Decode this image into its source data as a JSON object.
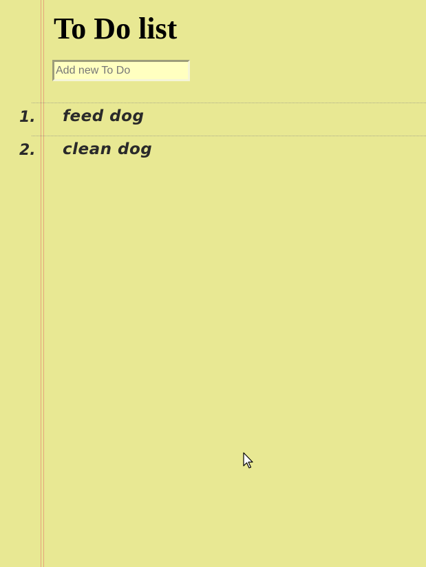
{
  "page": {
    "title": "To Do list"
  },
  "new_todo": {
    "placeholder": "Add new To Do",
    "value": ""
  },
  "todos": [
    {
      "number": "1.",
      "text": "feed dog"
    },
    {
      "number": "2.",
      "text": "clean dog"
    }
  ],
  "colors": {
    "paper": "#e8e893",
    "margin_line": "#e5a37a",
    "input_bg": "#ffffc0",
    "text": "#2a2a2a"
  },
  "icons": {
    "pointer": "mouse-pointer-icon"
  }
}
